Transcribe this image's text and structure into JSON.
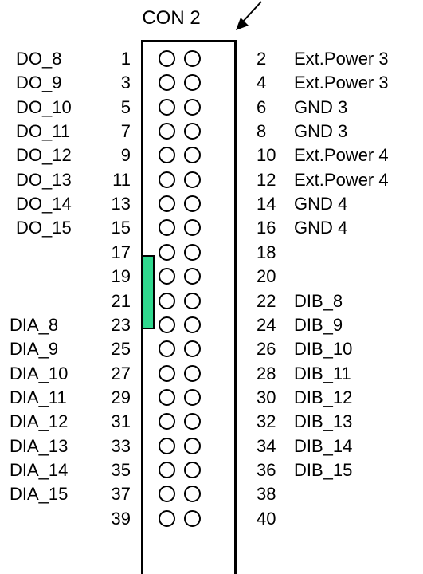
{
  "connector": {
    "title": "CON 2",
    "key_color": "#2fd88e",
    "arrow_icon": "pointer-arrow"
  },
  "rows": [
    {
      "left_signal": "DO_8",
      "left_pin": "1",
      "right_pin": "2",
      "right_signal": "Ext.Power 3"
    },
    {
      "left_signal": "DO_9",
      "left_pin": "3",
      "right_pin": "4",
      "right_signal": "Ext.Power 3"
    },
    {
      "left_signal": "DO_10",
      "left_pin": "5",
      "right_pin": "6",
      "right_signal": "GND 3"
    },
    {
      "left_signal": "DO_11",
      "left_pin": "7",
      "right_pin": "8",
      "right_signal": "GND 3"
    },
    {
      "left_signal": "DO_12",
      "left_pin": "9",
      "right_pin": "10",
      "right_signal": "Ext.Power 4"
    },
    {
      "left_signal": "DO_13",
      "left_pin": "11",
      "right_pin": "12",
      "right_signal": "Ext.Power 4"
    },
    {
      "left_signal": "DO_14",
      "left_pin": "13",
      "right_pin": "14",
      "right_signal": "GND 4"
    },
    {
      "left_signal": "DO_15",
      "left_pin": "15",
      "right_pin": "16",
      "right_signal": "GND 4"
    },
    {
      "left_signal": "",
      "left_pin": "17",
      "right_pin": "18",
      "right_signal": ""
    },
    {
      "left_signal": "",
      "left_pin": "19",
      "right_pin": "20",
      "right_signal": ""
    },
    {
      "left_signal": "",
      "left_pin": "21",
      "right_pin": "22",
      "right_signal": "DIB_8"
    },
    {
      "left_signal": "DIA_8",
      "left_pin": "23",
      "right_pin": "24",
      "right_signal": "DIB_9"
    },
    {
      "left_signal": "DIA_9",
      "left_pin": "25",
      "right_pin": "26",
      "right_signal": "DIB_10"
    },
    {
      "left_signal": "DIA_10",
      "left_pin": "27",
      "right_pin": "28",
      "right_signal": "DIB_11"
    },
    {
      "left_signal": "DIA_11",
      "left_pin": "29",
      "right_pin": "30",
      "right_signal": "DIB_12"
    },
    {
      "left_signal": "DIA_12",
      "left_pin": "31",
      "right_pin": "32",
      "right_signal": "DIB_13"
    },
    {
      "left_signal": "DIA_13",
      "left_pin": "33",
      "right_pin": "34",
      "right_signal": "DIB_14"
    },
    {
      "left_signal": "DIA_14",
      "left_pin": "35",
      "right_pin": "36",
      "right_signal": "DIB_15"
    },
    {
      "left_signal": "DIA_15",
      "left_pin": "37",
      "right_pin": "38",
      "right_signal": ""
    },
    {
      "left_signal": "",
      "left_pin": "39",
      "right_pin": "40",
      "right_signal": ""
    }
  ]
}
